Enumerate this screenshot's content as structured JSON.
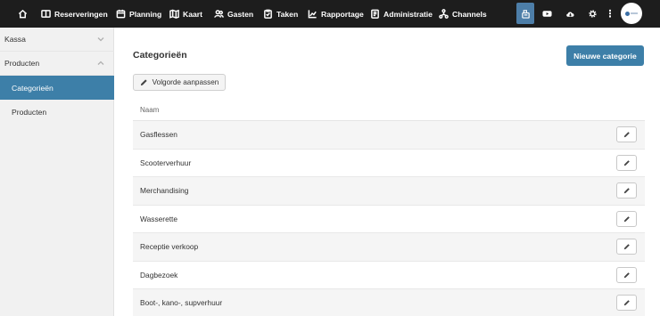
{
  "nav": {
    "items": [
      {
        "label": "Reserveringen",
        "icon": "book-icon"
      },
      {
        "label": "Planning",
        "icon": "calendar-icon"
      },
      {
        "label": "Kaart",
        "icon": "map-icon"
      },
      {
        "label": "Gasten",
        "icon": "users-icon"
      },
      {
        "label": "Taken",
        "icon": "clipboard-icon"
      },
      {
        "label": "Rapportage",
        "icon": "chart-icon"
      },
      {
        "label": "Administratie",
        "icon": "invoice-icon"
      },
      {
        "label": "Channels",
        "icon": "network-icon"
      }
    ],
    "more": "⋮",
    "active_color": "#4d7ea8"
  },
  "sidebar": {
    "groups": [
      {
        "label": "Kassa"
      },
      {
        "label": "Producten"
      }
    ],
    "items": [
      {
        "label": "Categorieën",
        "active": true
      },
      {
        "label": "Producten",
        "active": false
      }
    ],
    "active_color": "#3d7fa8"
  },
  "main": {
    "title": "Categorieën",
    "new_button": "Nieuwe categorie",
    "order_button": "Volgorde aanpassen",
    "table": {
      "header": "Naam",
      "rows": [
        "Gasflessen",
        "Scooterverhuur",
        "Merchandising",
        "Wasserette",
        "Receptie verkoop",
        "Dagbezoek",
        "Boot-, kano-, supverhuur"
      ]
    }
  }
}
